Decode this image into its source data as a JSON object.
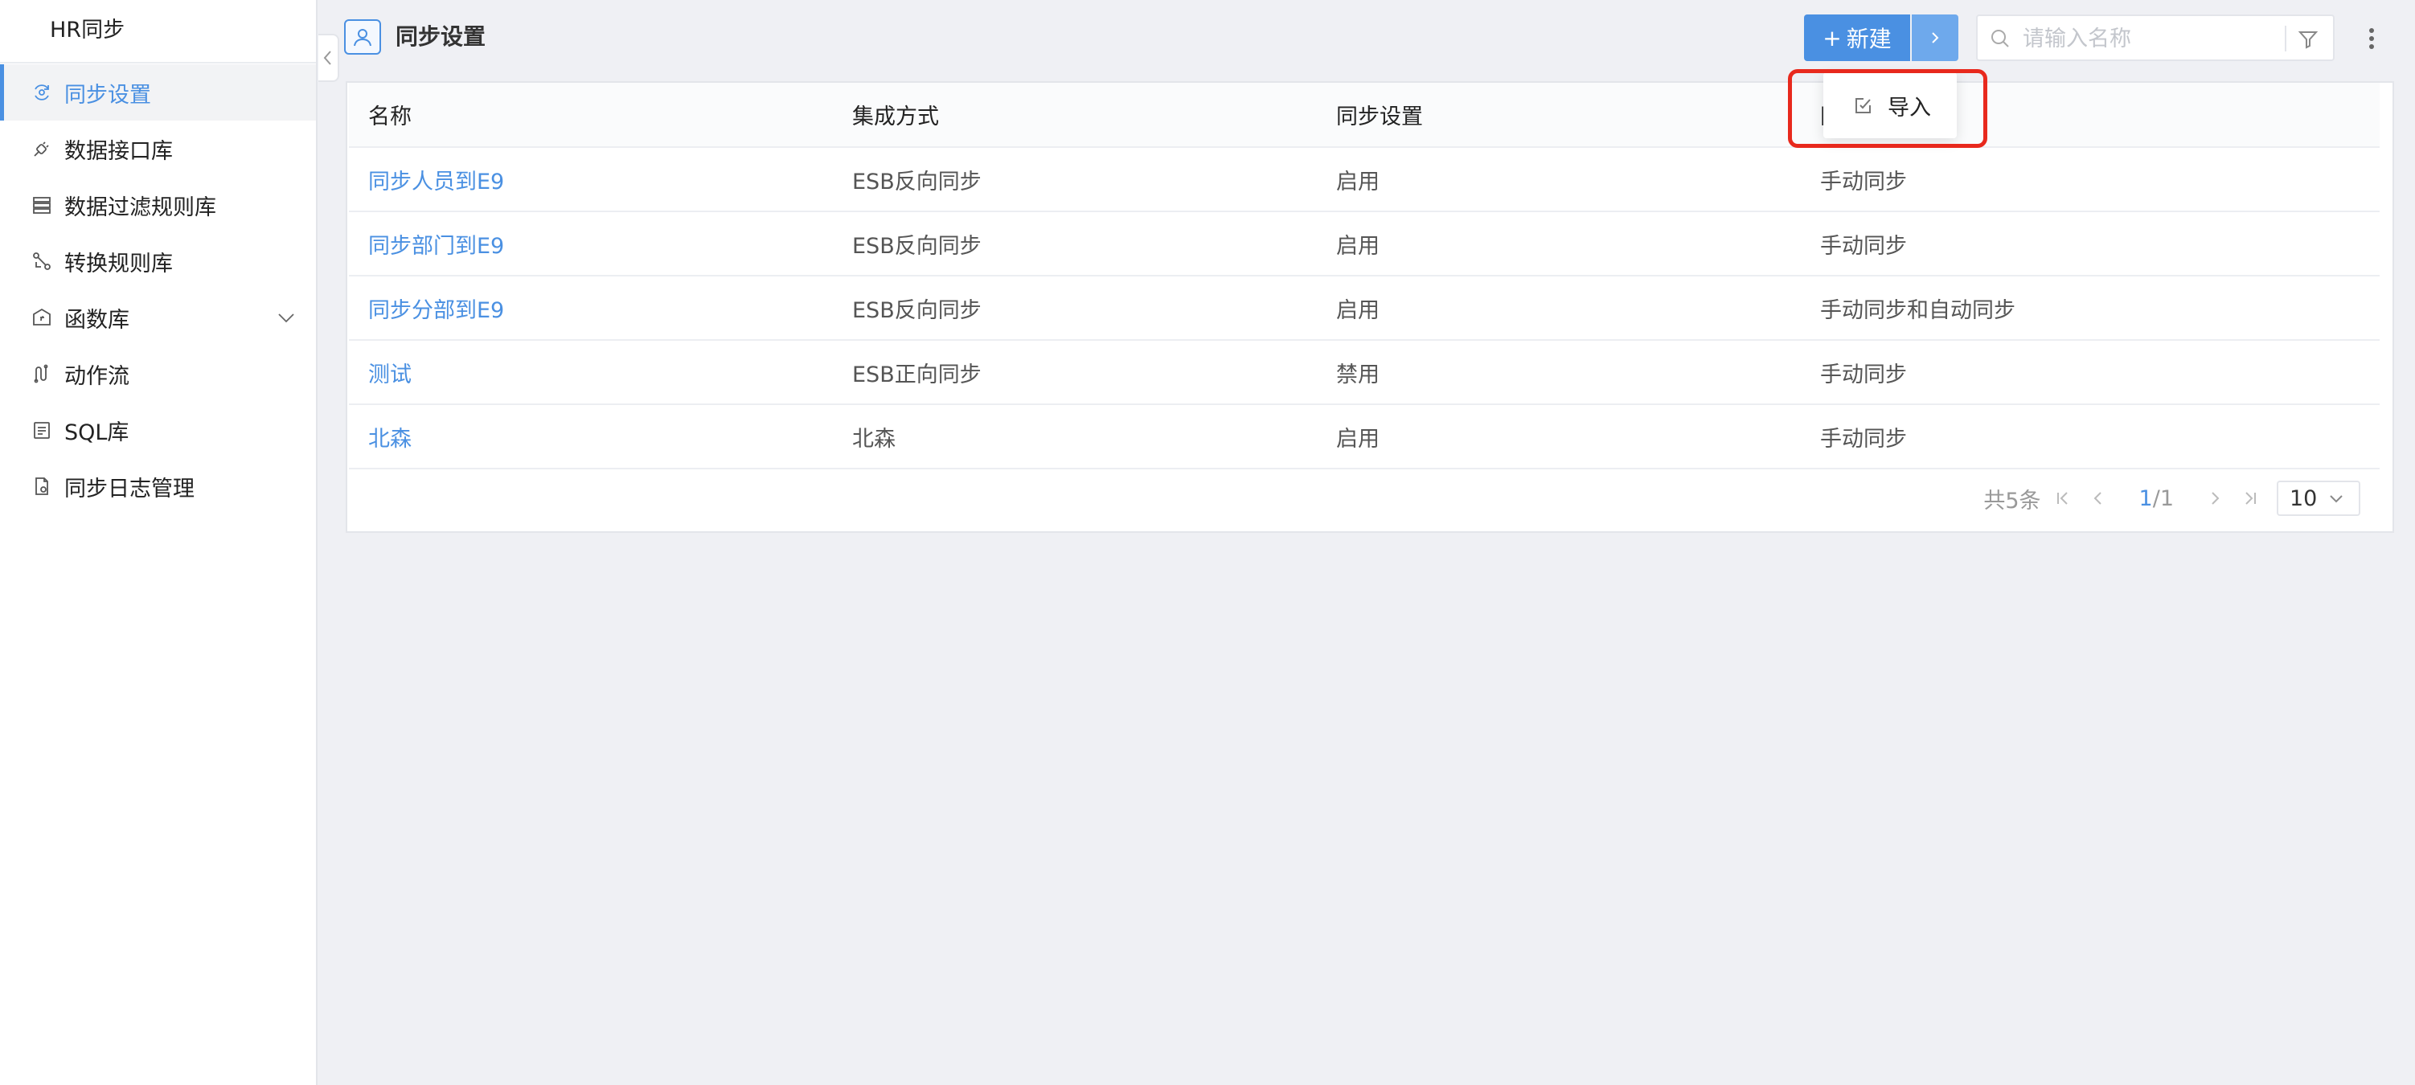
{
  "app": {
    "title": "HR同步"
  },
  "sidebar": {
    "items": [
      {
        "label": "同步设置",
        "icon": "sync-settings-icon",
        "active": true
      },
      {
        "label": "数据接口库",
        "icon": "plug-icon"
      },
      {
        "label": "数据过滤规则库",
        "icon": "database-icon"
      },
      {
        "label": "转换规则库",
        "icon": "transform-icon"
      },
      {
        "label": "函数库",
        "icon": "function-icon",
        "expandable": true
      },
      {
        "label": "动作流",
        "icon": "flow-icon"
      },
      {
        "label": "SQL库",
        "icon": "sql-icon"
      },
      {
        "label": "同步日志管理",
        "icon": "log-icon"
      }
    ]
  },
  "header": {
    "title": "同步设置",
    "new_button": "新建",
    "new_plus": "+",
    "search_placeholder": "请输入名称"
  },
  "dropdown": {
    "import_label": "导入"
  },
  "table": {
    "columns": [
      "名称",
      "集成方式",
      "同步设置",
      "同步方式"
    ],
    "rows": [
      [
        "同步人员到E9",
        "ESB反向同步",
        "启用",
        "手动同步"
      ],
      [
        "同步部门到E9",
        "ESB反向同步",
        "启用",
        "手动同步"
      ],
      [
        "同步分部到E9",
        "ESB反向同步",
        "启用",
        "手动同步和自动同步"
      ],
      [
        "测试",
        "ESB正向同步",
        "禁用",
        "手动同步"
      ],
      [
        "北森",
        "北森",
        "启用",
        "手动同步"
      ]
    ]
  },
  "pagination": {
    "total_text": "共5条",
    "current": "1",
    "separator": "/",
    "total_pages": "1",
    "page_size": "10"
  },
  "colors": {
    "accent": "#4a90e2",
    "highlight": "#e8291d"
  }
}
